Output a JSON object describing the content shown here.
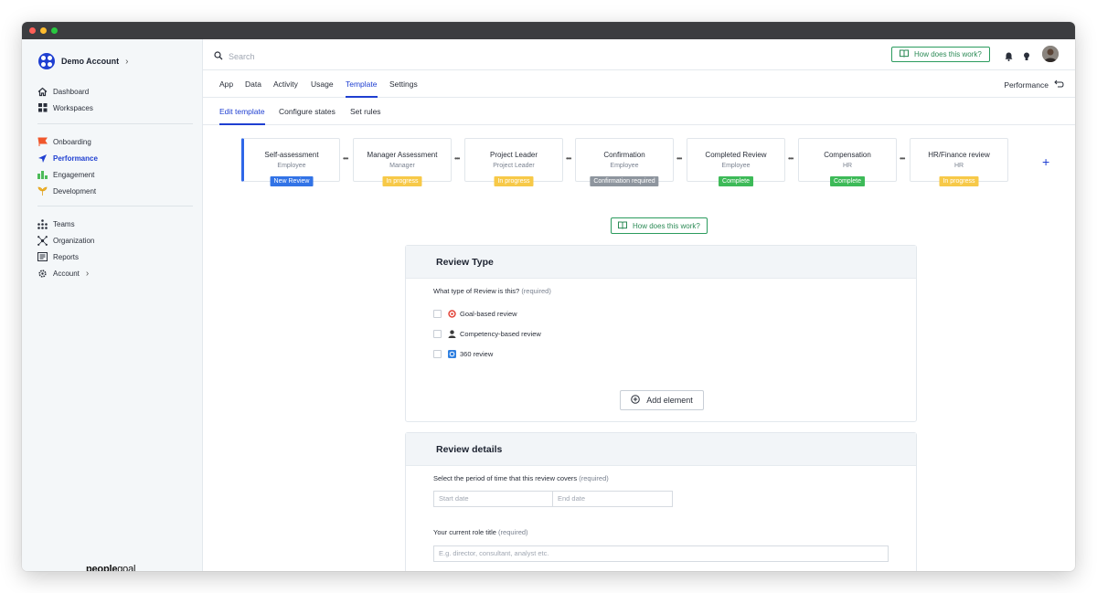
{
  "account": {
    "name": "Demo Account"
  },
  "sidebar": {
    "group1": [
      {
        "label": "Dashboard",
        "icon": "home-icon"
      },
      {
        "label": "Workspaces",
        "icon": "grid-icon"
      }
    ],
    "group2": [
      {
        "label": "Onboarding",
        "icon": "flag-icon"
      },
      {
        "label": "Performance",
        "icon": "send-icon",
        "active": true
      },
      {
        "label": "Engagement",
        "icon": "engagement-icon"
      },
      {
        "label": "Development",
        "icon": "sprout-icon"
      }
    ],
    "group3": [
      {
        "label": "Teams",
        "icon": "org-icon"
      },
      {
        "label": "Organization",
        "icon": "network-icon"
      },
      {
        "label": "Reports",
        "icon": "report-icon"
      },
      {
        "label": "Account",
        "icon": "gear-icon"
      }
    ],
    "brand_bold": "people",
    "brand_rest": "goal"
  },
  "header": {
    "search_placeholder": "Search",
    "how_label": "How does this work?"
  },
  "tabs": [
    "App",
    "Data",
    "Activity",
    "Usage",
    "Template",
    "Settings"
  ],
  "active_tab": "Template",
  "performance_link": "Performance",
  "subtabs": [
    "Edit template",
    "Configure states",
    "Set rules"
  ],
  "workflow": [
    {
      "name": "Self-assessment",
      "role": "Employee",
      "status": "New Review",
      "color": "#3273e6"
    },
    {
      "name": "Manager Assessment",
      "role": "Manager",
      "status": "In progress",
      "color": "#f7c948"
    },
    {
      "name": "Project Leader",
      "role": "Project Leader",
      "status": "In progress",
      "color": "#f7c948"
    },
    {
      "name": "Confirmation",
      "role": "Employee",
      "status": "Confirmation required",
      "color": "#8e959e"
    },
    {
      "name": "Completed Review",
      "role": "Employee",
      "status": "Complete",
      "color": "#3dba58"
    },
    {
      "name": "Compensation",
      "role": "HR",
      "status": "Complete",
      "color": "#3dba58"
    },
    {
      "name": "HR/Finance review",
      "role": "HR",
      "status": "In progress",
      "color": "#f7c948"
    }
  ],
  "review_type": {
    "title": "Review Type",
    "question": "What type of Review is this?",
    "required": "(required)",
    "options": [
      {
        "label": "Goal-based review",
        "icon": "target-icon"
      },
      {
        "label": "Competency-based review",
        "icon": "person-icon"
      },
      {
        "label": "360 review",
        "icon": "cycle-icon"
      }
    ],
    "add_element": "Add element"
  },
  "review_details": {
    "title": "Review details",
    "period_label": "Select the period of time that this review covers",
    "period_required": "(required)",
    "start_placeholder": "Start date",
    "end_placeholder": "End date",
    "role_label": "Your current role title",
    "role_required": "(required)",
    "role_placeholder": "E.g. director, consultant, analyst etc."
  },
  "colors": {
    "accent": "#1f3fd1",
    "how_green": "#2b8a55"
  }
}
